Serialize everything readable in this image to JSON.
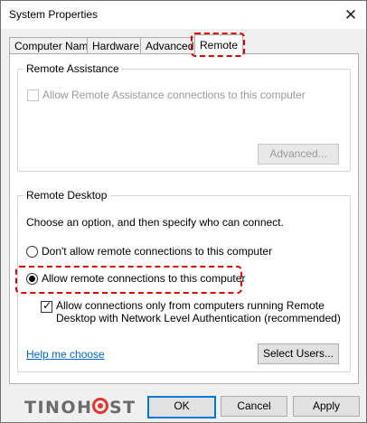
{
  "window": {
    "title": "System Properties"
  },
  "tabs": [
    {
      "label": "Computer Name"
    },
    {
      "label": "Hardware"
    },
    {
      "label": "Advanced"
    },
    {
      "label": "Remote"
    }
  ],
  "remote_assistance": {
    "group_title": "Remote Assistance",
    "checkbox_label": "Allow Remote Assistance connections to this computer",
    "checkbox_checked": false,
    "advanced_button": "Advanced..."
  },
  "remote_desktop": {
    "group_title": "Remote Desktop",
    "instructions": "Choose an option, and then specify who can connect.",
    "option_dont_allow": "Don't allow remote connections to this computer",
    "option_allow": "Allow remote connections to this computer",
    "selected_option": "allow",
    "nla_line1": "Allow connections only from computers running Remote",
    "nla_line2": "Desktop with Network Level Authentication (recommended)",
    "nla_checked": true,
    "help_link": "Help me choose",
    "select_users_button": "Select Users..."
  },
  "footer": {
    "ok_button": "OK",
    "cancel_button": "Cancel",
    "apply_button": "Apply",
    "watermark": "TINOHOST"
  }
}
